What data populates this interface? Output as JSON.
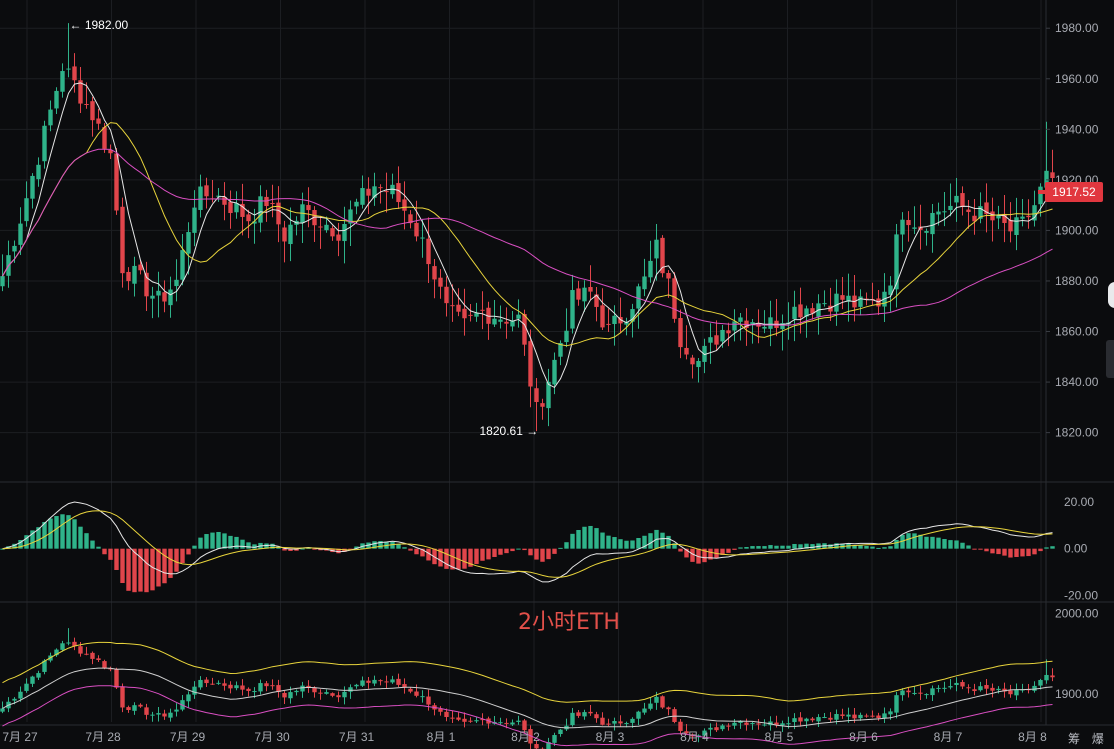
{
  "chart_data": {
    "type": "candlestick",
    "watermark": "2小时ETH",
    "current_price": "1917.52",
    "high_label": "← 1982.00",
    "low_label": "1820.61 →",
    "dates": [
      "7月 27",
      "7月 28",
      "7月 29",
      "7月 30",
      "7月 31",
      "8月 1",
      "8月 2",
      "8月 3",
      "8月 4",
      "8月 5",
      "8月 6",
      "8月 7",
      "8月 8"
    ],
    "main": {
      "ylim": [
        1806,
        1988
      ],
      "yticks": [
        "1980.00",
        "1960.00",
        "1940.00",
        "1920.00",
        "1900.00",
        "1880.00",
        "1860.00",
        "1840.00",
        "1820.00"
      ],
      "ytick_values": [
        1980,
        1960,
        1940,
        1920,
        1900,
        1880,
        1860,
        1840,
        1820
      ],
      "close_anchors": [
        [
          0,
          1882
        ],
        [
          3,
          1905
        ],
        [
          7,
          1938
        ],
        [
          10,
          1965
        ],
        [
          12,
          1958
        ],
        [
          15,
          1946
        ],
        [
          18,
          1930
        ],
        [
          20,
          1886
        ],
        [
          23,
          1880
        ],
        [
          26,
          1872
        ],
        [
          29,
          1880
        ],
        [
          32,
          1912
        ],
        [
          35,
          1915
        ],
        [
          38,
          1910
        ],
        [
          41,
          1905
        ],
        [
          44,
          1912
        ],
        [
          47,
          1898
        ],
        [
          50,
          1908
        ],
        [
          53,
          1904
        ],
        [
          56,
          1900
        ],
        [
          59,
          1910
        ],
        [
          62,
          1918
        ],
        [
          65,
          1915
        ],
        [
          68,
          1905
        ],
        [
          71,
          1890
        ],
        [
          74,
          1868
        ],
        [
          77,
          1862
        ],
        [
          80,
          1868
        ],
        [
          83,
          1866
        ],
        [
          86,
          1865
        ],
        [
          89,
          1828
        ],
        [
          92,
          1848
        ],
        [
          95,
          1872
        ],
        [
          98,
          1875
        ],
        [
          101,
          1860
        ],
        [
          104,
          1868
        ],
        [
          107,
          1880
        ],
        [
          109,
          1893
        ],
        [
          111,
          1878
        ],
        [
          113,
          1858
        ],
        [
          116,
          1848
        ],
        [
          119,
          1858
        ],
        [
          122,
          1866
        ],
        [
          125,
          1865
        ],
        [
          128,
          1863
        ],
        [
          131,
          1868
        ],
        [
          134,
          1870
        ],
        [
          137,
          1872
        ],
        [
          140,
          1873
        ],
        [
          143,
          1870
        ],
        [
          146,
          1872
        ],
        [
          148,
          1882
        ],
        [
          150,
          1908
        ],
        [
          153,
          1902
        ],
        [
          156,
          1908
        ],
        [
          159,
          1910
        ],
        [
          162,
          1907
        ],
        [
          165,
          1904
        ],
        [
          168,
          1900
        ],
        [
          170,
          1902
        ],
        [
          172,
          1910
        ],
        [
          174,
          1921
        ],
        [
          175,
          1917
        ]
      ],
      "ma_series": [
        {
          "color": "#e6e6e6",
          "period": 5
        },
        {
          "color": "#e8d43c",
          "period": 15
        },
        {
          "color": "#d94fc2",
          "period": 45
        }
      ]
    },
    "macd": {
      "ylim": [
        -22,
        26
      ],
      "yticks": [
        "20.00",
        "0.00",
        "-20.00"
      ],
      "ytick_values": [
        20,
        0,
        -20
      ]
    },
    "lower": {
      "ylim": [
        1865,
        2012
      ],
      "yticks": [
        "2000.00",
        "1900.00"
      ],
      "ytick_values": [
        2000,
        1900
      ]
    },
    "colors": {
      "up": "#2fb38a",
      "down": "#e1454b",
      "bg": "#0b0c0e",
      "grid": "#1c1e22"
    }
  },
  "toolbar": {
    "label": "筹 爆"
  }
}
